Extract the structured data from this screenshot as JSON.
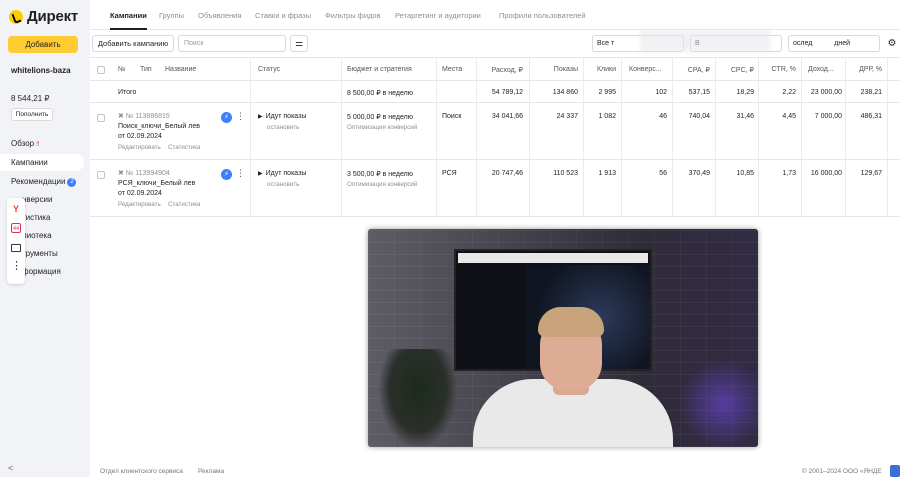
{
  "app": {
    "logo": "Директ"
  },
  "sidebar": {
    "add_button": "Добавить",
    "account": "whitelions-baza",
    "balance": "8 544,21 ₽",
    "topup_button": "Пополнить",
    "items": [
      {
        "label": "Обзор",
        "extra": "‼"
      },
      {
        "label": "Кампании"
      },
      {
        "label": "Рекомендации",
        "badge": "2"
      },
      {
        "label": "нверсии"
      },
      {
        "label": "тистика"
      },
      {
        "label": "лиотека"
      },
      {
        "label": "трументы"
      },
      {
        "label": "формация"
      }
    ],
    "overlay_icons": [
      "yandex-icon",
      "counter-icon",
      "screen-icon",
      "more-icon"
    ],
    "counter_value": "44",
    "collapse": "<"
  },
  "tabs": [
    "Кампании",
    "Группы",
    "Объявления",
    "Ставки и фразы",
    "Фильтры фидов",
    "Ретаргетинг и аудитории",
    "Профили пользователей"
  ],
  "toolbar": {
    "add_campaign": "Добавить кампанию",
    "search_placeholder": "Поиск",
    "select_1": "Все т",
    "select_2": "В",
    "select_3": "ослед",
    "select_3_tail": "дней"
  },
  "table": {
    "headers": {
      "no": "№",
      "type": "Тип",
      "name": "Название",
      "status": "Статус",
      "budget": "Бюджет и стратегия",
      "places": "Места",
      "spend": "Расход, ₽",
      "impressions": "Показы",
      "clicks": "Клики",
      "conversions": "Конверс...",
      "cpa": "CPA, ₽",
      "cpc": "CPC, ₽",
      "ctr": "CTR, %",
      "revenue": "Доход...",
      "drr": "ДРР, %"
    },
    "total": {
      "label": "Итого",
      "budget": "8 500,00 ₽ в неделю",
      "spend": "54 789,12",
      "impressions": "134 860",
      "clicks": "2 995",
      "conversions": "102",
      "cpa": "537,15",
      "cpc": "18,29",
      "ctr": "2,22",
      "revenue": "23 000,00",
      "drr": "238,21"
    },
    "rows": [
      {
        "id": "№ 113886815",
        "name_line1": "Поиск_ключи_Белый лев",
        "name_line2": "от 02.09.2024",
        "edit": "Редактировать",
        "stats": "Статистика",
        "status": "Идут показы",
        "stop": "остановить",
        "budget": "5 000,00 ₽ в неделю",
        "strategy": "Оптимизация конверсий",
        "places": "Поиск",
        "spend": "34 041,66",
        "impressions": "24 337",
        "clicks": "1 082",
        "conversions": "46",
        "cpa": "740,04",
        "cpc": "31,46",
        "ctr": "4,45",
        "revenue": "7 000,00",
        "drr": "486,31"
      },
      {
        "id": "№ 113994904",
        "name_line1": "РСЯ_ключи_Белый лев",
        "name_line2": "от 02.09.2024",
        "edit": "Редактировать",
        "stats": "Статистика",
        "status": "Идут показы",
        "stop": "остановить",
        "budget": "3 500,00 ₽ в неделю",
        "strategy": "Оптимизация конверсий",
        "places": "РСЯ",
        "spend": "20 747,46",
        "impressions": "110 523",
        "clicks": "1 913",
        "conversions": "56",
        "cpa": "370,49",
        "cpc": "10,85",
        "ctr": "1,73",
        "revenue": "16 000,00",
        "drr": "129,67"
      }
    ]
  },
  "footer": {
    "service": "Отдел клиентского сервиса",
    "ads": "Реклама",
    "copyright": "© 2001–2024 ООО «ЯНДЕ"
  }
}
